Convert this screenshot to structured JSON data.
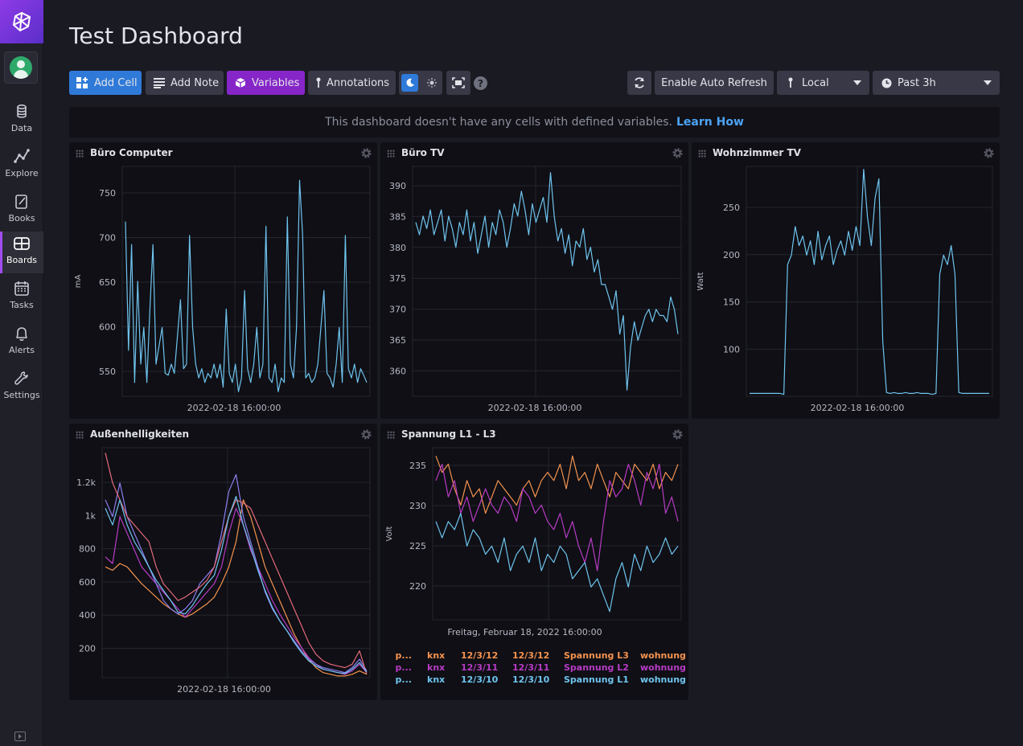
{
  "sidebar": {
    "items": [
      {
        "label": "Data",
        "icon": "database-icon"
      },
      {
        "label": "Explore",
        "icon": "graph-icon"
      },
      {
        "label": "Books",
        "icon": "notebook-icon"
      },
      {
        "label": "Boards",
        "icon": "dashboard-icon"
      },
      {
        "label": "Tasks",
        "icon": "calendar-icon"
      },
      {
        "label": "Alerts",
        "icon": "bell-icon"
      },
      {
        "label": "Settings",
        "icon": "wrench-icon"
      }
    ],
    "active": "Boards"
  },
  "dashboard": {
    "title": "Test Dashboard"
  },
  "toolbar": {
    "add_cell": "Add Cell",
    "add_note": "Add Note",
    "variables": "Variables",
    "annotations": "Annotations",
    "auto_refresh": "Enable Auto Refresh",
    "timezone": "Local",
    "time_range": "Past 3h"
  },
  "notice": {
    "text": "This dashboard doesn't have any cells with defined variables.",
    "link": "Learn How"
  },
  "colors": {
    "accent": "#2f7ad8",
    "brand": "#8626c8",
    "line_blue": "#6fc4ee",
    "line_orange": "#f4934f",
    "line_purple": "#b83bc5",
    "line_violet": "#8c7ff0"
  },
  "cells": [
    {
      "title": "Büro Computer",
      "ylabel": "mA",
      "xlabel": "2022-02-18 16:00:00",
      "yticks": [
        "750",
        "700",
        "650",
        "600",
        "550"
      ]
    },
    {
      "title": "Büro TV",
      "ylabel": "",
      "xlabel": "2022-02-18 16:00:00",
      "yticks": [
        "390",
        "385",
        "380",
        "375",
        "370",
        "365",
        "360"
      ]
    },
    {
      "title": "Wohnzimmer TV",
      "ylabel": "Watt",
      "xlabel": "2022-02-18 16:00:00",
      "yticks": [
        "250",
        "200",
        "150",
        "100"
      ]
    },
    {
      "title": "Außenhelligkeiten",
      "ylabel": "",
      "xlabel": "2022-02-18 16:00:00",
      "yticks": [
        "1.2k",
        "1k",
        "800",
        "600",
        "400",
        "200"
      ]
    },
    {
      "title": "Spannung L1 - L3",
      "ylabel": "Volt",
      "xlabel": "Freitag, Februar 18, 2022 16:00:00",
      "yticks": [
        "235",
        "230",
        "225",
        "220"
      ]
    }
  ],
  "legend": [
    {
      "color": "#f4934f",
      "cols": [
        "sp...",
        "knx",
        "12/3/12",
        "12/3/12",
        "Spannung L3",
        "wohnung"
      ]
    },
    {
      "color": "#b83bc5",
      "cols": [
        "sp...",
        "knx",
        "12/3/11",
        "12/3/11",
        "Spannung L2",
        "wohnung"
      ]
    },
    {
      "color": "#6fc4ee",
      "cols": [
        "sp...",
        "knx",
        "12/3/10",
        "12/3/10",
        "Spannung L1",
        "wohnung"
      ]
    }
  ],
  "chart_data": [
    {
      "type": "line",
      "title": "Büro Computer",
      "ylabel": "mA",
      "xlabel": "2022-02-18 16:00:00",
      "ylim": [
        525,
        775
      ],
      "series": [
        {
          "color": "#6fc4ee",
          "values": [
            715,
            575,
            690,
            540,
            650,
            560,
            600,
            540,
            620,
            690,
            560,
            580,
            600,
            550,
            548,
            560,
            550,
            590,
            630,
            555,
            560,
            700,
            600,
            560,
            545,
            555,
            540,
            550,
            545,
            560,
            545,
            560,
            535,
            620,
            550,
            540,
            560,
            530,
            545,
            640,
            555,
            540,
            560,
            600,
            545,
            560,
            710,
            545,
            540,
            560,
            530,
            545,
            540,
            720,
            560,
            545,
            600,
            760,
            700,
            545,
            550,
            540,
            545,
            560,
            600,
            640,
            550,
            545,
            535,
            560,
            600,
            540,
            700,
            555,
            545,
            560,
            540,
            555,
            548,
            540
          ]
        }
      ]
    },
    {
      "type": "line",
      "title": "Büro TV",
      "ylabel": "",
      "xlabel": "2022-02-18 16:00:00",
      "ylim": [
        356,
        393
      ],
      "series": [
        {
          "color": "#6fc4ee",
          "values": [
            384,
            382,
            385,
            383,
            386,
            382,
            384,
            386,
            381,
            385,
            383,
            380,
            384,
            382,
            386,
            381,
            384,
            379,
            382,
            385,
            380,
            384,
            382,
            386,
            384,
            380,
            383,
            387,
            385,
            389,
            386,
            382,
            387,
            384,
            386,
            388,
            384,
            392,
            385,
            381,
            383,
            379,
            382,
            377,
            381,
            380,
            383,
            378,
            380,
            376,
            378,
            374,
            374,
            372,
            370,
            373,
            366,
            369,
            357,
            364,
            368,
            365,
            367,
            369,
            370,
            368,
            370,
            369,
            369,
            368,
            372,
            370,
            366
          ]
        }
      ]
    },
    {
      "type": "line",
      "title": "Wohnzimmer TV",
      "ylabel": "Watt",
      "xlabel": "2022-02-18 16:00:00",
      "ylim": [
        52,
        293
      ],
      "series": [
        {
          "color": "#6fc4ee",
          "values": [
            55,
            55,
            55,
            55,
            55,
            55,
            55,
            55,
            55,
            54,
            190,
            200,
            230,
            210,
            220,
            200,
            215,
            190,
            225,
            195,
            210,
            220,
            190,
            205,
            215,
            200,
            225,
            205,
            230,
            210,
            290,
            240,
            210,
            260,
            280,
            110,
            56,
            55,
            56,
            55,
            55,
            56,
            55,
            55,
            56,
            55,
            55,
            55,
            54,
            55,
            180,
            200,
            190,
            210,
            180,
            56,
            55,
            55,
            55,
            55,
            55,
            55,
            55,
            55
          ]
        }
      ]
    },
    {
      "type": "line",
      "title": "Außenhelligkeiten",
      "ylabel": "",
      "xlabel": "2022-02-18 16:00:00",
      "ylim": [
        40,
        1410
      ],
      "series": [
        {
          "color": "#f4934f",
          "values": [
            700,
            680,
            720,
            700,
            650,
            600,
            560,
            520,
            480,
            450,
            420,
            400,
            420,
            450,
            480,
            520,
            600,
            700,
            850,
            1100,
            1000,
            850,
            700,
            600,
            500,
            400,
            300,
            220,
            150,
            100,
            70,
            60,
            50,
            50,
            60,
            80,
            60
          ]
        },
        {
          "color": "#b83bc5",
          "values": [
            760,
            720,
            1000,
            900,
            800,
            700,
            650,
            600,
            550,
            500,
            450,
            400,
            450,
            500,
            550,
            600,
            700,
            900,
            1050,
            950,
            800,
            700,
            600,
            500,
            420,
            350,
            280,
            220,
            160,
            120,
            90,
            80,
            70,
            60,
            80,
            120,
            70
          ]
        },
        {
          "color": "#8c7ff0",
          "values": [
            1100,
            1000,
            1200,
            1000,
            900,
            800,
            700,
            600,
            500,
            450,
            420,
            450,
            500,
            600,
            650,
            700,
            900,
            1150,
            1250,
            1000,
            850,
            700,
            550,
            450,
            380,
            320,
            260,
            200,
            150,
            120,
            100,
            90,
            80,
            70,
            100,
            150,
            80
          ]
        },
        {
          "color": "#e46a7a",
          "values": [
            1380,
            1200,
            1100,
            1000,
            950,
            900,
            850,
            700,
            600,
            550,
            500,
            520,
            550,
            580,
            620,
            700,
            850,
            1000,
            1100,
            1080,
            1050,
            950,
            850,
            750,
            650,
            550,
            450,
            350,
            250,
            180,
            140,
            120,
            110,
            100,
            120,
            200,
            60
          ]
        },
        {
          "color": "#6fc4ee",
          "values": [
            1050,
            950,
            1100,
            950,
            850,
            780,
            700,
            620,
            560,
            500,
            430,
            420,
            470,
            540,
            600,
            650,
            800,
            1000,
            1120,
            950,
            820,
            680,
            560,
            460,
            380,
            320,
            250,
            190,
            140,
            110,
            90,
            80,
            70,
            65,
            90,
            130,
            75
          ]
        }
      ]
    },
    {
      "type": "line",
      "title": "Spannung L1 - L3",
      "ylabel": "Volt",
      "xlabel": "Freitag, Februar 18, 2022 16:00:00",
      "ylim": [
        216,
        237
      ],
      "series": [
        {
          "name": "Spannung L3",
          "color": "#f4934f",
          "values": [
            236,
            234,
            235,
            232,
            230,
            233,
            231,
            232,
            229,
            231,
            233,
            232,
            231,
            230,
            232,
            233,
            231,
            233,
            234,
            233,
            235,
            232,
            236,
            233,
            234,
            232,
            235,
            233,
            231,
            234,
            233,
            232,
            235,
            234,
            233,
            235,
            232,
            234,
            233,
            235
          ]
        },
        {
          "name": "Spannung L2",
          "color": "#b83bc5",
          "values": [
            233,
            235,
            231,
            233,
            229,
            231,
            228,
            230,
            232,
            230,
            229,
            231,
            230,
            228,
            232,
            231,
            229,
            230,
            228,
            227,
            229,
            226,
            228,
            225,
            223,
            226,
            222,
            228,
            233,
            231,
            232,
            235,
            233,
            230,
            234,
            232,
            235,
            229,
            231,
            228
          ]
        },
        {
          "name": "Spannung L1",
          "color": "#6fc4ee",
          "values": [
            228,
            226,
            228,
            227,
            229,
            225,
            227,
            226,
            224,
            225,
            223,
            226,
            222,
            224,
            225,
            223,
            226,
            222,
            224,
            223,
            225,
            224,
            221,
            222,
            223,
            220,
            221,
            219,
            217,
            221,
            223,
            220,
            224,
            222,
            225,
            223,
            224,
            226,
            224,
            225
          ]
        }
      ]
    }
  ]
}
